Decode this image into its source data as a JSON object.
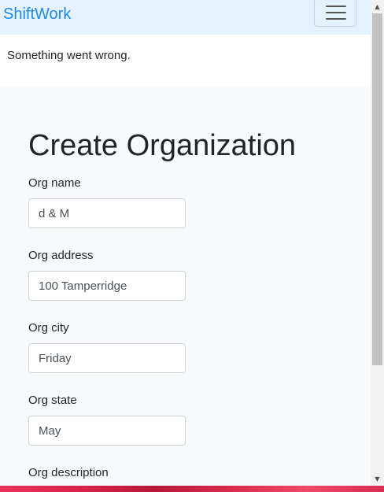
{
  "navbar": {
    "brand": "ShiftWork",
    "toggler_icon": "hamburger-menu-icon"
  },
  "alert": {
    "message": "Something went wrong."
  },
  "form": {
    "title": "Create Organization",
    "fields": [
      {
        "label": "Org name",
        "value": "d & M"
      },
      {
        "label": "Org address",
        "value": "100 Tamperridge"
      },
      {
        "label": "Org city",
        "value": "Friday"
      },
      {
        "label": "Org state",
        "value": "May"
      },
      {
        "label": "Org description",
        "value": ""
      }
    ]
  },
  "scrollbar": {
    "up_icon": "scroll-up-arrow-icon",
    "down_icon": "scroll-down-arrow-icon",
    "up_glyph": "▲",
    "down_glyph": "▼"
  },
  "colors": {
    "navbar_bg": "#e3f2fd",
    "brand": "#1e88e5",
    "content_bg": "#f8f9fa"
  }
}
